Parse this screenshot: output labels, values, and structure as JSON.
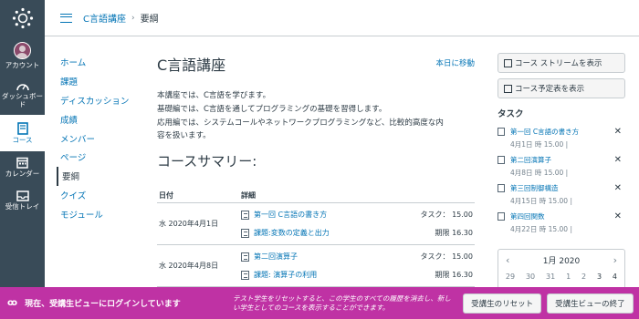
{
  "global_nav": {
    "items": [
      {
        "label": "アカウント",
        "icon": "avatar"
      },
      {
        "label": "ダッシュボード",
        "icon": "dashboard-icon"
      },
      {
        "label": "コース",
        "icon": "book-icon",
        "active": true
      },
      {
        "label": "カレンダー",
        "icon": "calendar-icon"
      },
      {
        "label": "受信トレイ",
        "icon": "inbox-icon"
      }
    ]
  },
  "header": {
    "course": "C言語講座",
    "separator": "›",
    "current": "要綱"
  },
  "course_nav": {
    "items": [
      "ホーム",
      "課題",
      "ディスカッション",
      "成績",
      "メンバー",
      "ページ",
      "要綱",
      "クイズ",
      "モジュール"
    ],
    "active_index": 6
  },
  "main": {
    "title": "C言語講座",
    "today_link": "本日に移動",
    "description": [
      "本講座では、C言語を学びます。",
      "基礎編では、C言語を通してプログラミングの基礎を習得します。",
      "応用編では、システムコールやネットワークプログラミングなど、比較的高度な内",
      "容を扱います。"
    ],
    "summary_title": "コースサマリー:",
    "table": {
      "headers": [
        "日付",
        "詳細"
      ],
      "days": [
        {
          "date": "水 2020年4月1日",
          "events": [
            {
              "title": "第一回 C言語の書き方",
              "meta": "タスク： 15.00",
              "icon": "page-icon"
            },
            {
              "title": "課題:変数の定義と出力",
              "meta": "期限 16.30",
              "icon": "assignment-icon"
            }
          ]
        },
        {
          "date": "水 2020年4月8日",
          "events": [
            {
              "title": "第二回演算子",
              "meta": "タスク： 15.00",
              "icon": "page-icon"
            },
            {
              "title": "課題: 演算子の利用",
              "meta": "期限 16.30",
              "icon": "assignment-icon"
            }
          ]
        }
      ]
    }
  },
  "sidebar": {
    "buttons": [
      "コース ストリームを表示",
      "コース予定表を表示"
    ],
    "todo_title": "タスク",
    "todos": [
      {
        "title": "第一回 C言語の書き方",
        "date": "4月1日 時 15.00  |"
      },
      {
        "title": "第二回演算子",
        "date": "4月8日 時 15.00  |"
      },
      {
        "title": "第三回制御構造",
        "date": "4月15日 時 15.00  |"
      },
      {
        "title": "第四回関数",
        "date": "4月22日 時 15.00  |"
      }
    ],
    "calendar": {
      "month": "1月 2020",
      "prev": "‹",
      "next": "›",
      "days": [
        "29",
        "30",
        "31",
        "1",
        "2",
        "3",
        "4"
      ]
    }
  },
  "student_view": {
    "icon": "ꝏ",
    "label": "現在、受講生ビューにログインしています",
    "note": "テスト学生をリセットすると、この学生のすべての履歴を消去し、新しい学生としてのコースを表示することができます。",
    "reset_button": "受講生のリセット",
    "exit_button": "受講生ビューの終了"
  },
  "colors": {
    "nav_bg": "#394b58",
    "link": "#0374b5",
    "student_bar": "#bf32a4"
  }
}
